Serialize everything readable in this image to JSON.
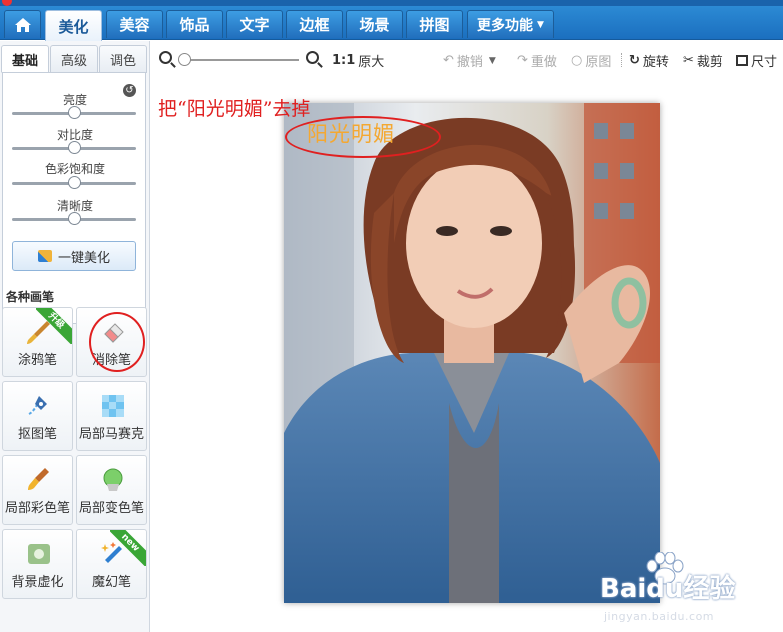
{
  "nav": {
    "home_icon": "home-icon",
    "tabs": [
      "美化",
      "美容",
      "饰品",
      "文字",
      "边框",
      "场景",
      "拼图"
    ],
    "more": "更多功能",
    "active": "美化"
  },
  "left": {
    "tabs": [
      "基础",
      "高级",
      "调色"
    ],
    "sliders": [
      {
        "label": "亮度",
        "level": 0.5
      },
      {
        "label": "对比度",
        "level": 0.5
      },
      {
        "label": "色彩饱和度",
        "level": 0.5
      },
      {
        "label": "清晰度",
        "level": 0.5
      }
    ],
    "one_key": "一键美化",
    "brush_section": "各种画笔",
    "tools": [
      {
        "label": "涂鸦笔",
        "badge": "升级"
      },
      {
        "label": "消除笔",
        "badge": ""
      },
      {
        "label": "抠图笔",
        "badge": ""
      },
      {
        "label": "局部马赛克",
        "badge": ""
      },
      {
        "label": "局部彩色笔",
        "badge": ""
      },
      {
        "label": "局部变色笔",
        "badge": ""
      },
      {
        "label": "背景虚化",
        "badge": ""
      },
      {
        "label": "魔幻笔",
        "badge": "new"
      }
    ]
  },
  "toolbar": {
    "zoom_level": 0.0,
    "ratio": "1:1",
    "original_size": "原大",
    "undo": "撤销",
    "redo": "重做",
    "original": "原图",
    "rotate": "旋转",
    "crop": "裁剪",
    "size": "尺寸"
  },
  "canvas": {
    "note": "把“阳光明媚”去掉",
    "overlay_text": "阳光明媚"
  },
  "watermark": {
    "brand": "Baidu经验",
    "url": "jingyan.baidu.com"
  },
  "colors": {
    "nav_blue": "#2f8fd8",
    "annotation_red": "#e02020",
    "overlay_orange": "#f4a832",
    "badge_green": "#3aa636"
  }
}
